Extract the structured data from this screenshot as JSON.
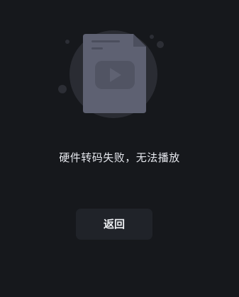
{
  "error_screen": {
    "icon": "broken-video-file-icon",
    "message": "硬件转码失败，无法播放",
    "back_button_label": "返回"
  },
  "colors": {
    "background": "#16181c",
    "button_background": "#202329",
    "text": "#e6e8ee",
    "illustration_circle": "#2a2c33",
    "illustration_file": "#5e6172"
  }
}
